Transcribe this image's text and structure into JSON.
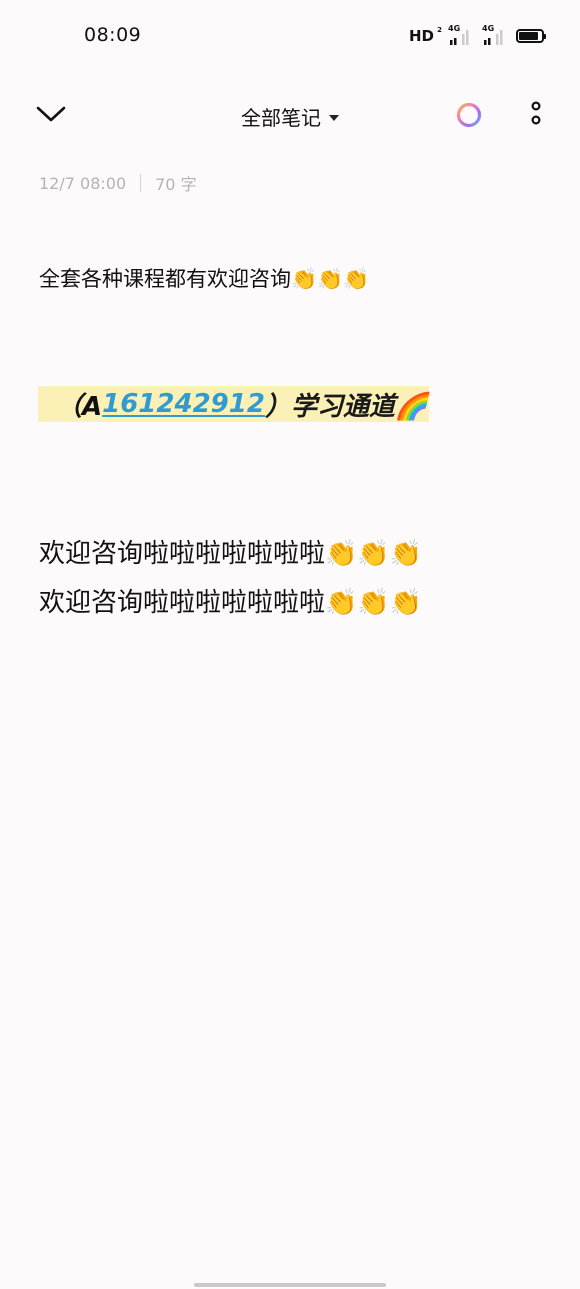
{
  "status_bar": {
    "time": "08:09",
    "network_type": "HD",
    "network_sub": "2",
    "signal1_label": "4G",
    "signal2_label": "4G",
    "battery_level": 0.85
  },
  "app_bar": {
    "title": "全部笔记",
    "back_icon": "chevron-down-icon",
    "theme_icon": "color-ring-icon",
    "more_icon": "more-vertical-icon"
  },
  "note": {
    "date": "12/7 08:00",
    "word_count": "70 字",
    "line1": "全套各种课程都有欢迎咨询👏👏👏",
    "highlight_prefix": "（A",
    "highlight_link": "161242912",
    "highlight_suffix": "）学习通道🌈",
    "line3": "欢迎咨询啦啦啦啦啦啦啦👏👏👏",
    "line4": "欢迎咨询啦啦啦啦啦啦啦👏👏👏"
  },
  "colors": {
    "background": "#fdfafc",
    "link": "#2f9bd0",
    "highlight": "#fbf0b5",
    "meta_text": "#b3b3b3"
  }
}
